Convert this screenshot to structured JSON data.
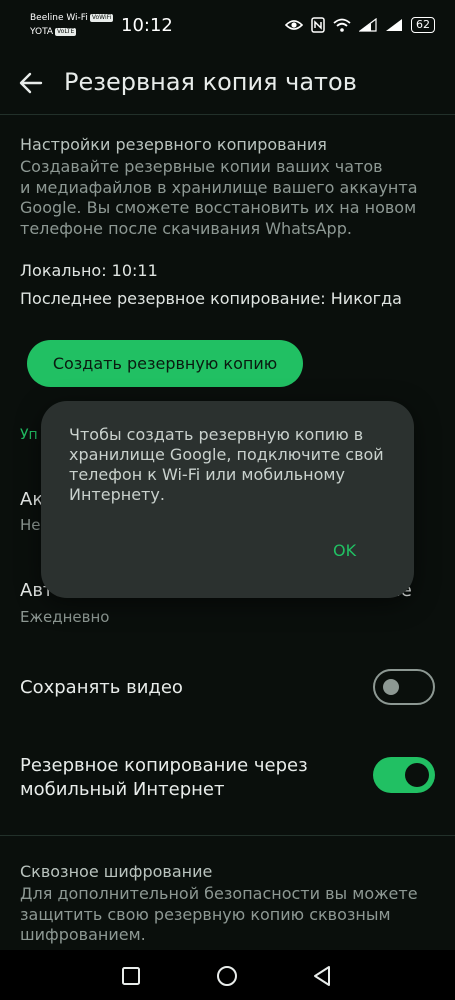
{
  "status_bar": {
    "carrier1": "Beeline Wi-Fi",
    "carrier1_tag": "VoWiFi",
    "carrier2": "YOTA",
    "carrier2_tag": "VoLTE",
    "time": "10:12",
    "battery": "62"
  },
  "app_bar": {
    "title": "Резервная копия чатов"
  },
  "backup_settings": {
    "label": "Настройки резервного копирования",
    "description_lines": [
      "Создавайте резервные копии ваших чатов",
      "и медиафайлов в хранилище вашего аккаунта",
      "Google. Вы сможете восстановить их на новом",
      "телефоне после скачивания WhatsApp."
    ],
    "local": "Локально: 10:11",
    "last_backup": "Последнее резервное копирование: Никогда",
    "create_button": "Создать резервную копию"
  },
  "behind_dialog": {
    "green_label": "Уп",
    "account_title": "Ак",
    "account_sub": "Не",
    "auto_backup_left": "Авто",
    "auto_backup_right": "ие",
    "auto_backup_sub": "Ежедневно"
  },
  "settings": {
    "save_video": "Сохранять видео",
    "save_video_on": false,
    "mobile_backup_lines": [
      "Резервное копирование через",
      "мобильный Интернет"
    ],
    "mobile_backup_on": true
  },
  "encryption": {
    "label": "Сквозное шифрование",
    "description_lines": [
      "Для дополнительной безопасности вы можете",
      "защитить свою резервную копию сквозным",
      "шифрованием."
    ]
  },
  "dialog": {
    "message_lines": [
      "Чтобы создать резервную копию в",
      "хранилище Google, подключите свой",
      "телефон к Wi-Fi или мобильному",
      "Интернету."
    ],
    "ok": "OK"
  },
  "colors": {
    "accent": "#21c063",
    "background": "#0a0f0c",
    "dialog": "#2b312f"
  }
}
